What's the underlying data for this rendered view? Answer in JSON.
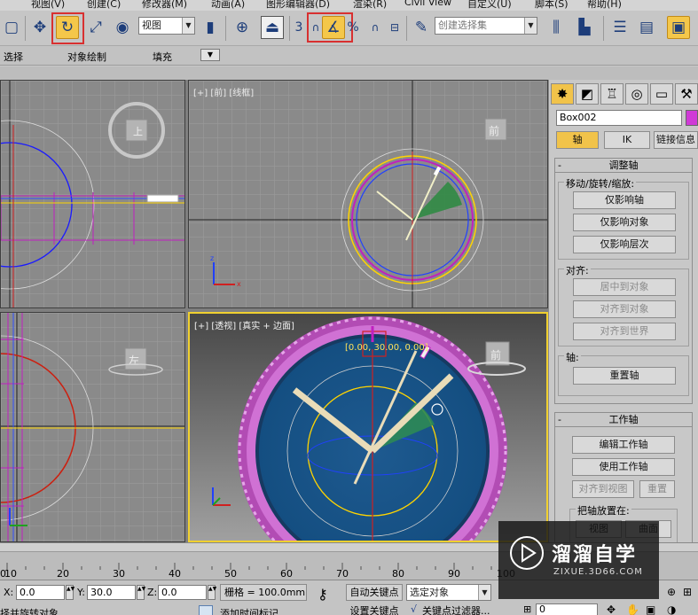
{
  "menu": [
    "视图(V)",
    "创建(C)",
    "修改器(M)",
    "动画(A)",
    "图形编辑器(D)",
    "渲染(R)",
    "Civil View",
    "自定义(U)",
    "脚本(S)",
    "帮助(H)"
  ],
  "toolbar": {
    "view_combo": "视图",
    "selection_set": "创建选择集",
    "snap_label": "3",
    "percent_label": "%"
  },
  "ribbon": {
    "items": [
      "选择",
      "对象绘制",
      "填充"
    ]
  },
  "viewports": {
    "front_label": "[+] [前] [线框]",
    "persp_label": "[+] [透视] [真实 + 边面]",
    "front_cube": "前",
    "top_cube": "上",
    "left_cube": "左",
    "persp_cube": "前",
    "coord_readout": "[0.00, 30.00, 0.00]"
  },
  "panel": {
    "object_name": "Box002",
    "tabs": [
      "轴",
      "IK",
      "链接信息"
    ],
    "adjust_pivot": {
      "title": "调整轴",
      "group_move": "移动/旋转/缩放:",
      "buttons": [
        "仅影响轴",
        "仅影响对象",
        "仅影响层次"
      ],
      "group_align": "对齐:",
      "align_buttons": [
        "居中到对象",
        "对齐到对象",
        "对齐到世界"
      ],
      "group_pivot": "轴:",
      "reset_pivot": "重置轴"
    },
    "working_pivot": {
      "title": "工作轴",
      "edit": "编辑工作轴",
      "use": "使用工作轴",
      "align_view": "对齐到视图",
      "reset": "重置",
      "place_pivot": "把轴放置在:",
      "place_a": "视图",
      "place_b": "曲面"
    }
  },
  "timeline": {
    "ticks": [
      "0",
      "10",
      "20",
      "30",
      "40",
      "50",
      "60",
      "70",
      "80",
      "90",
      "100"
    ]
  },
  "status": {
    "x_label": "X:",
    "x_value": "0.0",
    "y_label": "Y:",
    "y_value": "30.0",
    "z_label": "Z:",
    "z_value": "0.0",
    "grid": "栅格 = 100.0mm",
    "autokey": "自动关键点",
    "selected_obj": "选定对象",
    "set_key": "设置关键点",
    "key_filter": "关键点过滤器...",
    "frame": "0",
    "prompt1": "择并旋转对象",
    "prompt2": "添加时间标记"
  },
  "watermark": {
    "brand": "溜溜自学",
    "url": "ZIXUE.3D66.COM"
  }
}
